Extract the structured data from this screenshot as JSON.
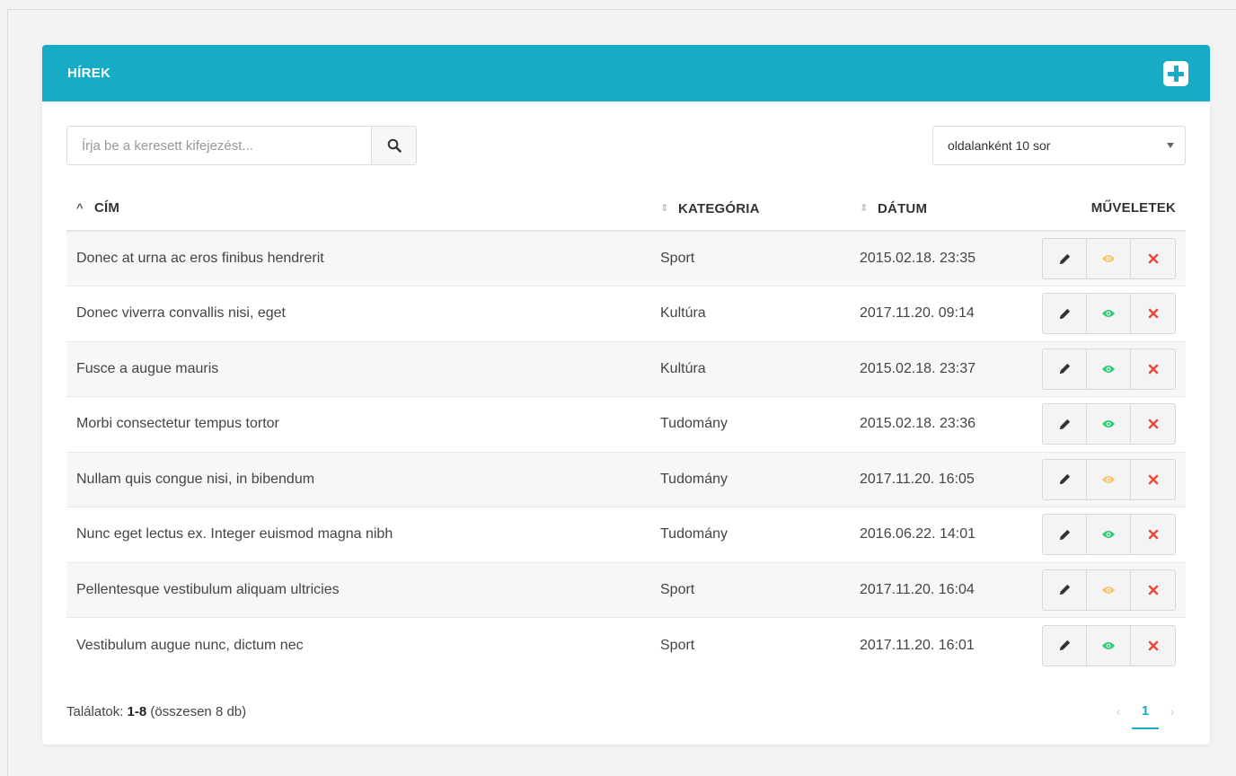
{
  "panel": {
    "title": "HÍREK",
    "accent_color": "#17acc6",
    "add_icon": "plus-square-icon"
  },
  "search": {
    "placeholder": "Írja be a keresett kifejezést...",
    "value": "",
    "button_icon": "search-icon"
  },
  "page_size_select": {
    "selected": "oldalanként 10 sor"
  },
  "table": {
    "columns": {
      "title": "CÍM",
      "category": "KATEGÓRIA",
      "date": "DÁTUM",
      "actions": "MŰVELETEK"
    },
    "sorted_by": "title",
    "sort_direction": "asc",
    "rows": [
      {
        "title": "Donec at urna ac eros finibus hendrerit",
        "category": "Sport",
        "date": "2015.02.18. 23:35",
        "visible": false
      },
      {
        "title": "Donec viverra convallis nisi, eget",
        "category": "Kultúra",
        "date": "2017.11.20. 09:14",
        "visible": true
      },
      {
        "title": "Fusce a augue mauris",
        "category": "Kultúra",
        "date": "2015.02.18. 23:37",
        "visible": true
      },
      {
        "title": "Morbi consectetur tempus tortor",
        "category": "Tudomány",
        "date": "2015.02.18. 23:36",
        "visible": true
      },
      {
        "title": "Nullam quis congue nisi, in bibendum",
        "category": "Tudomány",
        "date": "2017.11.20. 16:05",
        "visible": false
      },
      {
        "title": "Nunc eget lectus ex. Integer euismod magna nibh",
        "category": "Tudomány",
        "date": "2016.06.22. 14:01",
        "visible": true
      },
      {
        "title": "Pellentesque vestibulum aliquam ultricies",
        "category": "Sport",
        "date": "2017.11.20. 16:04",
        "visible": false
      },
      {
        "title": "Vestibulum augue nunc, dictum nec",
        "category": "Sport",
        "date": "2017.11.20. 16:01",
        "visible": true
      }
    ],
    "action_icons": [
      "pencil-icon",
      "eye-icon",
      "close-icon"
    ],
    "colors": {
      "visible_eye": "#2ecc71",
      "hidden_eye": "#f8c470",
      "delete": "#e74c3c",
      "edit": "#333333"
    }
  },
  "footer": {
    "results_label": "Találatok:",
    "results_range": "1-8",
    "results_total": "(összesen 8 db)"
  },
  "pagination": {
    "pages": [
      "1"
    ],
    "current": "1",
    "prev_symbol": "‹",
    "next_symbol": "›"
  }
}
